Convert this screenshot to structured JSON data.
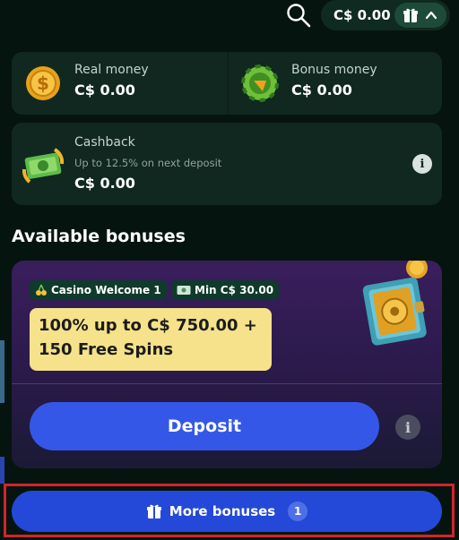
{
  "header": {
    "balance": "C$ 0.00"
  },
  "wallet": {
    "real_label": "Real money",
    "real_value": "C$ 0.00",
    "bonus_label": "Bonus money",
    "bonus_value": "C$ 0.00"
  },
  "cashback": {
    "title": "Cashback",
    "subtitle": "Up to 12.5% on next deposit",
    "value": "C$ 0.00"
  },
  "bonuses": {
    "section_title": "Available bonuses",
    "offer": {
      "tag_name": "Casino Welcome 1",
      "tag_min": "Min C$ 30.00",
      "headline": "100% up to C$ 750.00 +\n150 Free Spins",
      "deposit_label": "Deposit"
    },
    "more_label": "More bonuses",
    "more_count": "1"
  },
  "colors": {
    "background": "#06140f",
    "card": "#102820",
    "accent_blue": "#3557e8",
    "offer_yellow": "#f5e28a",
    "highlight_red": "#d4242a"
  },
  "icons": [
    "search-icon",
    "gift-icon",
    "chevron-up-icon",
    "coin-icon",
    "chip-icon",
    "cashback-icon",
    "info-icon",
    "cherry-icon",
    "banknote-icon",
    "safe-icon"
  ]
}
